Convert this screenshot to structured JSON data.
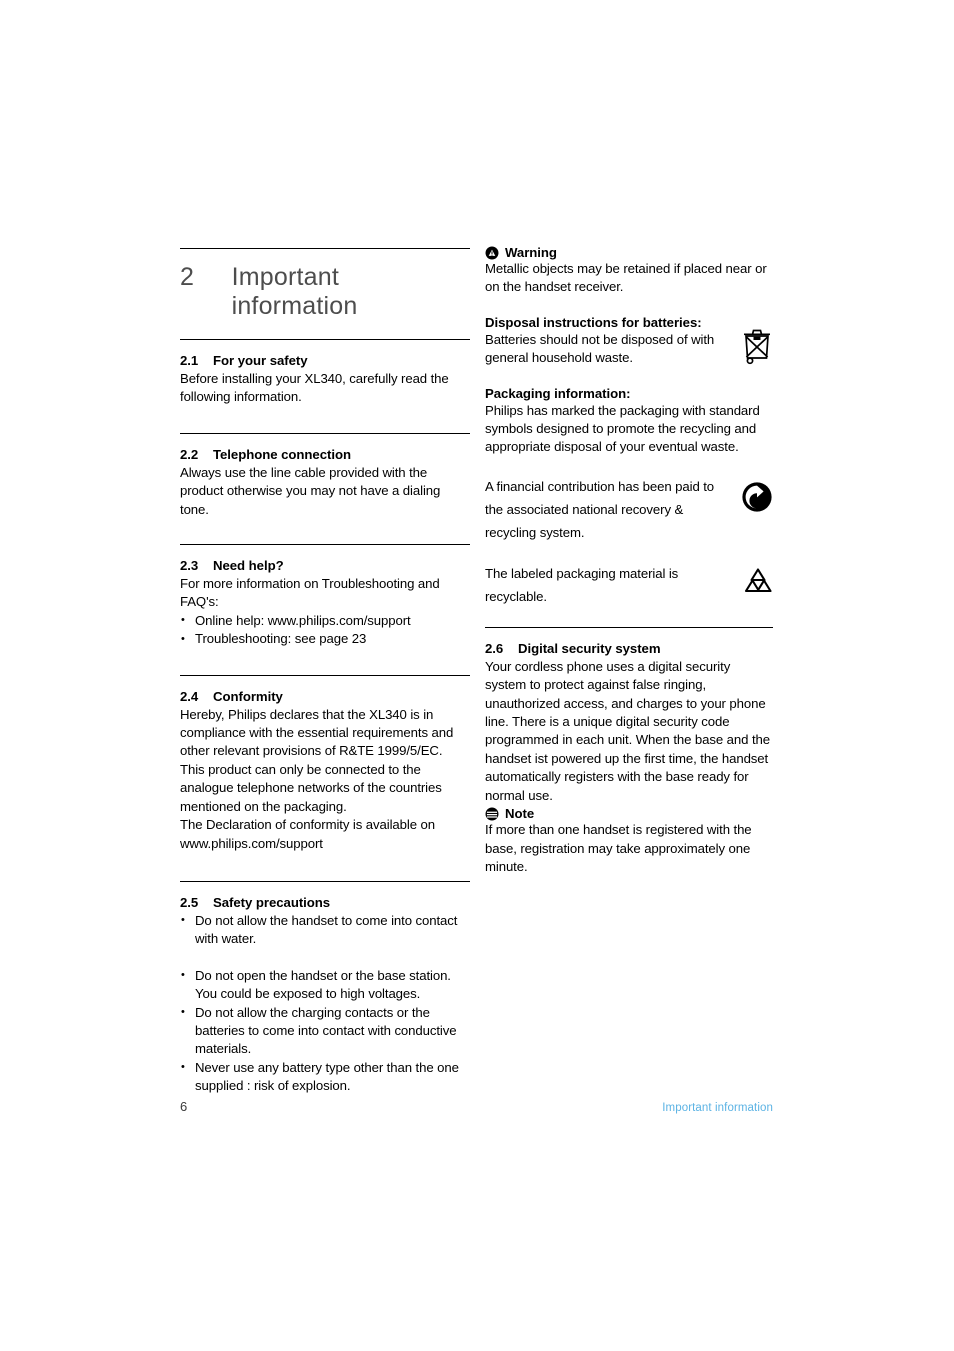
{
  "document": {
    "chapter_number": "2",
    "chapter_title": "Important information",
    "footer": {
      "page_number": "6",
      "running_title": "Important information",
      "running_title_color": "#5cb3e4"
    }
  },
  "left_column": {
    "sections": [
      {
        "number": "2.1",
        "title": "For your safety",
        "paragraphs": [
          "Before installing your XL340, carefully read the following information."
        ]
      },
      {
        "number": "2.2",
        "title": "Telephone connection",
        "paragraphs": [
          "Always use the line cable provided with the product otherwise you may not have a dialing tone."
        ]
      },
      {
        "number": "2.3",
        "title": "Need help?",
        "paragraphs": [
          "For more information on Troubleshooting and FAQ's:"
        ],
        "bullets": [
          "Online help: www.philips.com/support",
          "Troubleshooting: see page 23"
        ]
      },
      {
        "number": "2.4",
        "title": "Conformity",
        "paragraphs": [
          "Hereby, Philips declares that the XL340 is in compliance with the essential requirements and other relevant provisions of R&TE 1999/5/EC. This product can only be connected to the analogue telephone networks of the countries mentioned on the packaging.",
          "The Declaration of conformity is available on www.philips.com/support"
        ]
      },
      {
        "number": "2.5",
        "title": "Safety precautions",
        "bullets": [
          "Do not allow the handset to come into contact with water.",
          "Do not open the handset or the base station. You could be exposed to high voltages.",
          "Do not allow the charging contacts or the batteries to come into contact with conductive materials.",
          "Never use any battery type other than the one supplied : risk of explosion."
        ]
      }
    ]
  },
  "right_column": {
    "warning": {
      "icon": "warning-triangle-icon",
      "label": "Warning",
      "text": "Metallic objects may be retained if placed near or on the handset receiver."
    },
    "battery_disposal": {
      "heading": "Disposal instructions for batteries:",
      "text": "Batteries should not be disposed of with general household waste.",
      "icon": "crossed-out-wheelie-bin-icon"
    },
    "packaging": {
      "heading": "Packaging information:",
      "text": "Philips has marked the packaging with standard symbols designed to promote the recycling and appropriate disposal of your eventual waste.",
      "green_dot": {
        "text": "A financial contribution has been paid to the associated national recovery & recycling system.",
        "icon": "green-dot-recycling-icon"
      },
      "recyclable": {
        "text": "The labeled packaging material is recyclable.",
        "icon": "mobius-loop-recycling-icon"
      }
    },
    "section": {
      "number": "2.6",
      "title": "Digital security system",
      "text": "Your cordless phone uses a digital security system to protect against false ringing, unauthorized access, and charges to your phone line. There is a unique digital security code programmed in each unit. When the base and the handset ist powered up the first time, the handset automatically registers with the base ready for normal use."
    },
    "note": {
      "icon": "note-lines-icon",
      "label": "Note",
      "text": "If more than one handset is registered with the base, registration may take approximately one minute."
    }
  }
}
